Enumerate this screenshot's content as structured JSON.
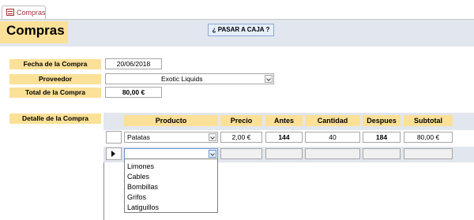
{
  "tab": {
    "label": "Compras",
    "icon": "form-icon"
  },
  "header": {
    "title": "Compras",
    "pasar_button": "¿ PASAR A CAJA ?"
  },
  "form": {
    "fecha_label": "Fecha de la Compra",
    "fecha_value": "20/06/2018",
    "proveedor_label": "Proveedor",
    "proveedor_value": "Exotic Liquids",
    "total_label": "Total de la Compra",
    "total_value": "80,00 €"
  },
  "detalle": {
    "label": "Detalle de la Compra",
    "columns": [
      "Producto",
      "Precio",
      "Antes",
      "Cantidad",
      "Despues",
      "Subtotal"
    ],
    "rows": [
      {
        "producto": "Patatas",
        "precio": "2,00 €",
        "antes": "144",
        "cantidad": "40",
        "despues": "184",
        "subtotal": "80,00 €"
      }
    ],
    "dropdown_options": [
      "Limones",
      "Cables",
      "Bombillas",
      "Grifos",
      "Latiguillos"
    ]
  },
  "colors": {
    "label_bg": "#fbe097",
    "header_bg": "#e2e6ee",
    "tab_accent": "#a4373a"
  }
}
